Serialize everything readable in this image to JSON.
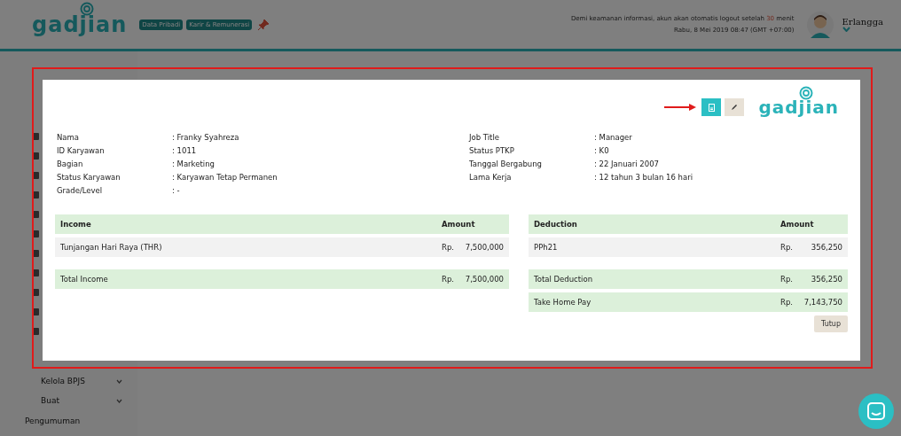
{
  "header": {
    "logo": "gadjian",
    "badges": [
      "Data Pribadi",
      "Karir & Remunerasi"
    ],
    "notice": {
      "before": "Demi keamanan informasi, akun akan otomatis logout setelah",
      "minutes": "30",
      "after": "menit"
    },
    "datetime": "Rabu, 8 Mei 2019 08:47 (GMT +07:00)",
    "user": "Erlangga"
  },
  "sidebar": {
    "items": [
      {
        "label": "Kelola BPJS",
        "expanded": false
      },
      {
        "label": "Buat",
        "expanded": false
      }
    ],
    "footer": "Pengumuman"
  },
  "modal": {
    "logo": "gadjian",
    "left_info": [
      {
        "label": "Nama",
        "value": ": Franky Syahreza"
      },
      {
        "label": "ID Karyawan",
        "value": ": 1011"
      },
      {
        "label": "Bagian",
        "value": ": Marketing"
      },
      {
        "label": "Status Karyawan",
        "value": ": Karyawan Tetap Permanen"
      },
      {
        "label": "Grade/Level",
        "value": ": -"
      }
    ],
    "right_info": [
      {
        "label": "Job Title",
        "value": ": Manager"
      },
      {
        "label": "Status PTKP",
        "value": ": K0"
      },
      {
        "label": "Tanggal Bergabung",
        "value": ": 22 Januari 2007"
      },
      {
        "label": "Lama Kerja",
        "value": ": 12 tahun 3 bulan 16 hari"
      }
    ],
    "income": {
      "columns": [
        "Income",
        "Amount"
      ],
      "rows": [
        {
          "name": "Tunjangan Hari Raya (THR)",
          "currency": "Rp.",
          "amount": "7,500,000"
        }
      ],
      "totals": [
        {
          "name": "Total Income",
          "currency": "Rp.",
          "amount": "7,500,000"
        }
      ]
    },
    "deduction": {
      "columns": [
        "Deduction",
        "Amount"
      ],
      "rows": [
        {
          "name": "PPh21",
          "currency": "Rp.",
          "amount": "356,250"
        }
      ],
      "totals": [
        {
          "name": "Total Deduction",
          "currency": "Rp.",
          "amount": "356,250"
        },
        {
          "name": "Take Home Pay",
          "currency": "Rp.",
          "amount": "7,143,750"
        }
      ]
    },
    "close_button": "Tutup"
  }
}
